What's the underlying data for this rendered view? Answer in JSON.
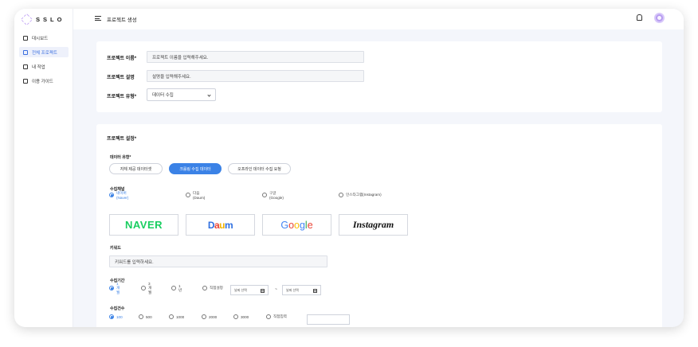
{
  "app": {
    "logo": "SSLO"
  },
  "sidebar": {
    "items": [
      {
        "label": "대시보드",
        "icon": "dashboard-icon"
      },
      {
        "label": "전체 프로젝트",
        "icon": "folder-icon",
        "active": true
      },
      {
        "label": "내 작업",
        "icon": "briefcase-icon"
      },
      {
        "label": "이용 가이드",
        "icon": "guide-icon"
      }
    ]
  },
  "header": {
    "title": "프로젝트 생성"
  },
  "basic": {
    "name_label": "프로젝트 이름*",
    "name_placeholder": "프로젝트 이름을 입력해주세요.",
    "desc_label": "프로젝트 설명",
    "desc_placeholder": "설명을 입력해주세요.",
    "type_label": "프로젝트 유형*",
    "type_value": "데이터 수집"
  },
  "settings": {
    "title": "프로젝트 설정*",
    "data_type_label": "데이터 유형*",
    "data_types": [
      {
        "label": "자체 제공 데이터셋",
        "active": false
      },
      {
        "label": "크롤링 수집 데이터",
        "active": true
      },
      {
        "label": "오프라인 데이터 수집 요청",
        "active": false
      }
    ],
    "channel_label": "수집채널",
    "channels": [
      {
        "label": "네이버(Naver)",
        "selected": true,
        "logo": "NAVER"
      },
      {
        "label": "다음(Daum)",
        "selected": false,
        "logo": "Daum"
      },
      {
        "label": "구글(Google)",
        "selected": false,
        "logo": "Google"
      },
      {
        "label": "인스타그램(Instagram)",
        "selected": false,
        "logo": "Instagram"
      }
    ],
    "keyword_label": "키워드",
    "keyword_placeholder": "키워드를 입력하세요.",
    "period_label": "수집기간",
    "periods": [
      {
        "label": "1개월",
        "selected": true
      },
      {
        "label": "3개월",
        "selected": false
      },
      {
        "label": "1년",
        "selected": false
      },
      {
        "label": "직접설정",
        "selected": false
      }
    ],
    "date_start_placeholder": "날짜 선택",
    "date_end_placeholder": "날짜 선택",
    "date_separator": "~",
    "count_label": "수집건수",
    "counts": [
      {
        "label": "100",
        "selected": true
      },
      {
        "label": "500",
        "selected": false
      },
      {
        "label": "1000",
        "selected": false
      },
      {
        "label": "2000",
        "selected": false
      },
      {
        "label": "3000",
        "selected": false
      },
      {
        "label": "직접입력",
        "selected": false
      }
    ]
  },
  "colors": {
    "accent": "#3b82e6",
    "naver": "#19ce60",
    "avatar": "#b79cf0"
  }
}
